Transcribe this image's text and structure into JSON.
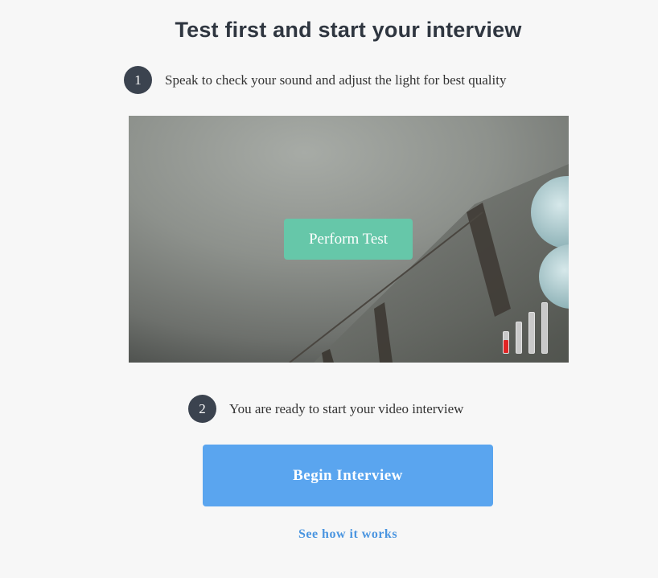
{
  "header": {
    "title": "Test first and start your interview"
  },
  "steps": [
    {
      "number": "1",
      "text": "Speak to check your sound and adjust the light for best quality"
    },
    {
      "number": "2",
      "text": "You are ready to start your video interview"
    }
  ],
  "video": {
    "perform_test_label": "Perform Test",
    "audio_level": 0.15
  },
  "actions": {
    "begin_label": "Begin Interview",
    "see_how_label": "See how it works"
  },
  "colors": {
    "step_badge": "#3b434f",
    "perform_test": "#66c7a9",
    "begin_button": "#5aa5ef",
    "link": "#4a95e0",
    "audio_low": "#e02424"
  }
}
